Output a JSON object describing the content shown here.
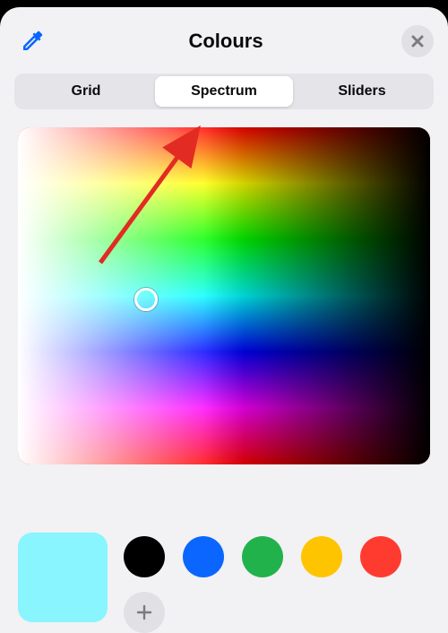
{
  "header": {
    "title": "Colours",
    "eyedropper_color": "#0a66ff"
  },
  "tabs": {
    "items": [
      {
        "label": "Grid",
        "active": false
      },
      {
        "label": "Spectrum",
        "active": true
      },
      {
        "label": "Sliders",
        "active": false
      }
    ]
  },
  "spectrum": {
    "reticle": {
      "left_pct": 31,
      "top_pct": 51
    }
  },
  "current_color": "#88f5ff",
  "preset_swatches": [
    "#000000",
    "#0a66ff",
    "#22b24c",
    "#ffc400",
    "#ff3b30"
  ],
  "annotation": {
    "kind": "arrow",
    "color": "#e22b22",
    "points_to": "spectrum-tab"
  }
}
